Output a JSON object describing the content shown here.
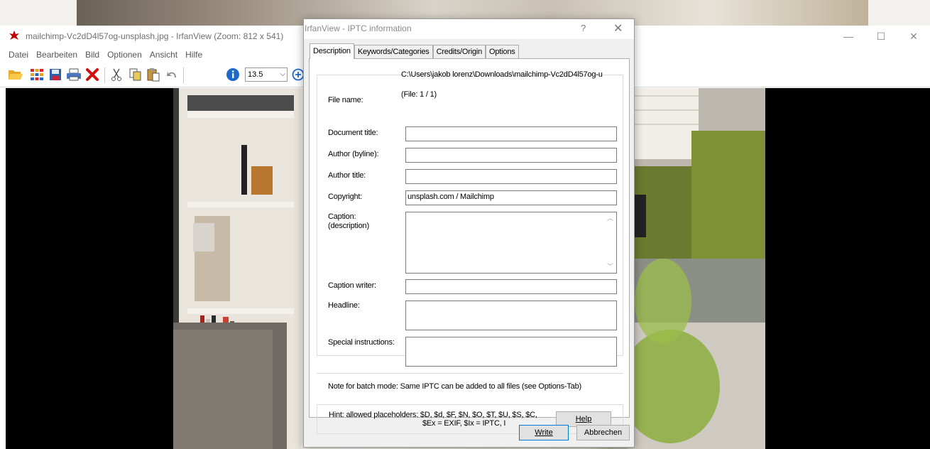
{
  "main_window": {
    "title": "mailchimp-Vc2dD4l57og-unsplash.jpg - IrfanView (Zoom: 812 x 541)",
    "controls": {
      "minimize": "—",
      "maximize": "☐",
      "close": "✕"
    },
    "menu": [
      "Datei",
      "Bearbeiten",
      "Bild",
      "Optionen",
      "Ansicht",
      "Hilfe"
    ],
    "toolbar": {
      "buttons": [
        "open-folder-icon",
        "thumbnails-icon",
        "save-icon",
        "print-icon",
        "delete-icon",
        "cut-icon",
        "copy-icon",
        "paste-icon",
        "undo-icon",
        "info-icon",
        "zoom-in-icon"
      ],
      "zoom_value": "13.5"
    }
  },
  "dialog": {
    "title": "IrfanView - IPTC information",
    "help_glyph": "?",
    "close_glyph": "✕",
    "tabs": [
      "Description",
      "Keywords/Categories",
      "Credits/Origin",
      "Options"
    ],
    "active_tab": "Description",
    "fields": {
      "file_name_label": "File name:",
      "file_path": "C:\\Users\\jakob lorenz\\Downloads\\mailchimp-Vc2dD4l57og-u",
      "file_count": "(File: 1 / 1)",
      "document_title_label": "Document title:",
      "document_title_value": "",
      "author_label": "Author (byline):",
      "author_value": "",
      "author_title_label": "Author title:",
      "author_title_value": "",
      "copyright_label": "Copyright:",
      "copyright_value": "unsplash.com / Mailchimp",
      "caption_label_1": "Caption:",
      "caption_label_2": "(description)",
      "caption_value": "",
      "caption_writer_label": "Caption writer:",
      "caption_writer_value": "",
      "headline_label": "Headline:",
      "headline_value": "",
      "special_instructions_label": "Special instructions:",
      "special_instructions_value": ""
    },
    "note": "Note for batch mode: Same IPTC can be added to all files (see Options-Tab)",
    "hint_line1": "Hint: allowed placeholders: $D, $d, $F, $N, $O, $T, $U, $S, $C,",
    "hint_line2": "$Ex = EXIF, $Ix = IPTC, I",
    "help_button": "Help",
    "write_button": "Write",
    "cancel_button": "Abbrechen"
  },
  "colors": {
    "dialog_bg": "#f0f0f0",
    "focus_border": "#0078d7",
    "delete_red": "#d01010"
  }
}
